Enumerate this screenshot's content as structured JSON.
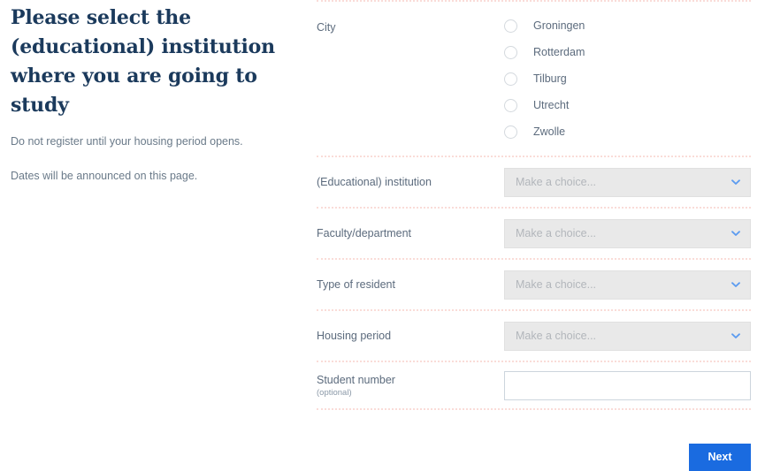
{
  "intro": {
    "title": "Please select the (educational) institution where you are going to study",
    "note_1": "Do not register until your housing period opens.",
    "note_2": "Dates will be announced on this page."
  },
  "form": {
    "city": {
      "label": "City",
      "options": [
        {
          "label": "Groningen",
          "selected": false
        },
        {
          "label": "Rotterdam",
          "selected": false
        },
        {
          "label": "Tilburg",
          "selected": false
        },
        {
          "label": "Utrecht",
          "selected": false
        },
        {
          "label": "Zwolle",
          "selected": false
        }
      ]
    },
    "institution": {
      "label": "(Educational) institution",
      "value": "Make a choice...",
      "caret_icon": "chevron-down-icon"
    },
    "faculty": {
      "label": "Faculty/department",
      "value": "Make a choice...",
      "caret_icon": "chevron-down-icon"
    },
    "resident_type": {
      "label": "Type of resident",
      "value": "Make a choice...",
      "caret_icon": "chevron-down-icon"
    },
    "housing_period": {
      "label": "Housing period",
      "value": "Make a choice...",
      "caret_icon": "chevron-down-icon"
    },
    "student_number": {
      "label": "Student number",
      "sublabel": "(optional)",
      "value": "",
      "placeholder": ""
    },
    "next_button": "Next"
  },
  "colors": {
    "heading": "#1b3a5c",
    "label": "#5c6b7d",
    "placeholder": "#b2b6bb",
    "separator": "#fadcd8",
    "select_bg": "#e9e9e9",
    "accent_blue": "#1a6be0",
    "caret_blue": "#5b9bf0"
  }
}
